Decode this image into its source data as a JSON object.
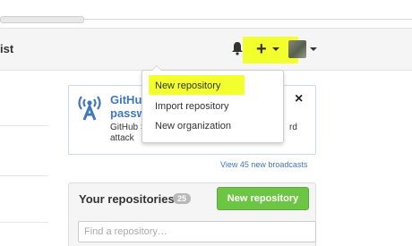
{
  "header": {
    "left_text": "ist"
  },
  "icons": {
    "bell": "bell-icon",
    "plus": "plus-icon",
    "broadcast": "broadcast-icon",
    "close": "close-icon"
  },
  "colors": {
    "highlight": "#f4ff2e",
    "link": "#4078c0",
    "new_button": "#6cc644"
  },
  "menu": {
    "items": [
      {
        "label": "New repository"
      },
      {
        "label": "Import repository"
      },
      {
        "label": "New organization"
      }
    ]
  },
  "broadcast": {
    "title_line1": "GitHub",
    "title_line2": "passw",
    "body_line1": "GitHub S",
    "body_line1_suffix": "rd",
    "body_line2": "attack",
    "close_symbol": "×",
    "view_all_link": "View 45 new broadcasts"
  },
  "repositories": {
    "heading": "Your repositories",
    "count": "25",
    "new_button_label": "New repository",
    "search_placeholder": "Find a repository…"
  }
}
